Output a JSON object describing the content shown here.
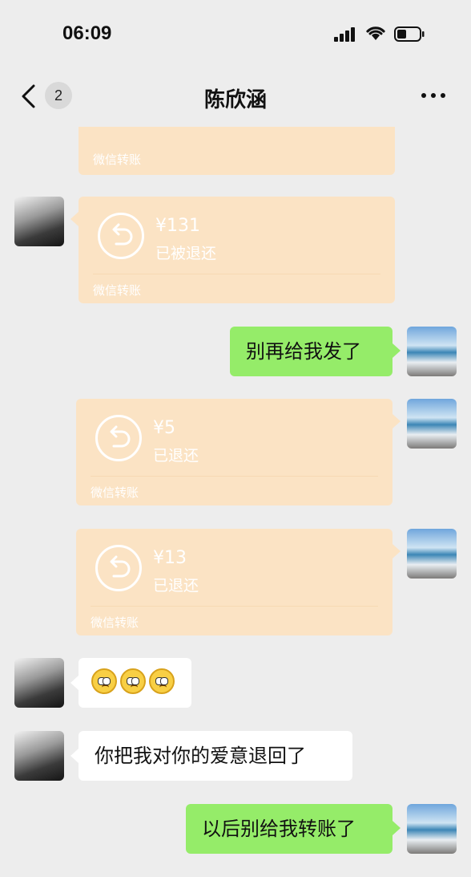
{
  "status": {
    "time": "06:09"
  },
  "nav": {
    "badge_count": "2",
    "title": "陈欣涵"
  },
  "messages": {
    "top_partial": {
      "label": "微信转账"
    },
    "t1": {
      "amount": "¥131",
      "status": "已被退还",
      "label": "微信转账"
    },
    "m_dont_send": {
      "text": "别再给我发了"
    },
    "t2": {
      "amount": "¥5",
      "status": "已退还",
      "label": "微信转账"
    },
    "t3": {
      "amount": "¥13",
      "status": "已退还",
      "label": "微信转账"
    },
    "m_emoji": {
      "emoji_names": [
        "pleading-face",
        "pleading-face",
        "pleading-face"
      ]
    },
    "m_love_returned": {
      "text": "你把我对你的爱意退回了"
    },
    "m_no_more_transfers": {
      "text": "以后别给我转账了"
    }
  },
  "colors": {
    "background": "#ededed",
    "green_bubble": "#95ec69",
    "transfer_card": "#fbe3c4",
    "white_bubble": "#ffffff"
  }
}
